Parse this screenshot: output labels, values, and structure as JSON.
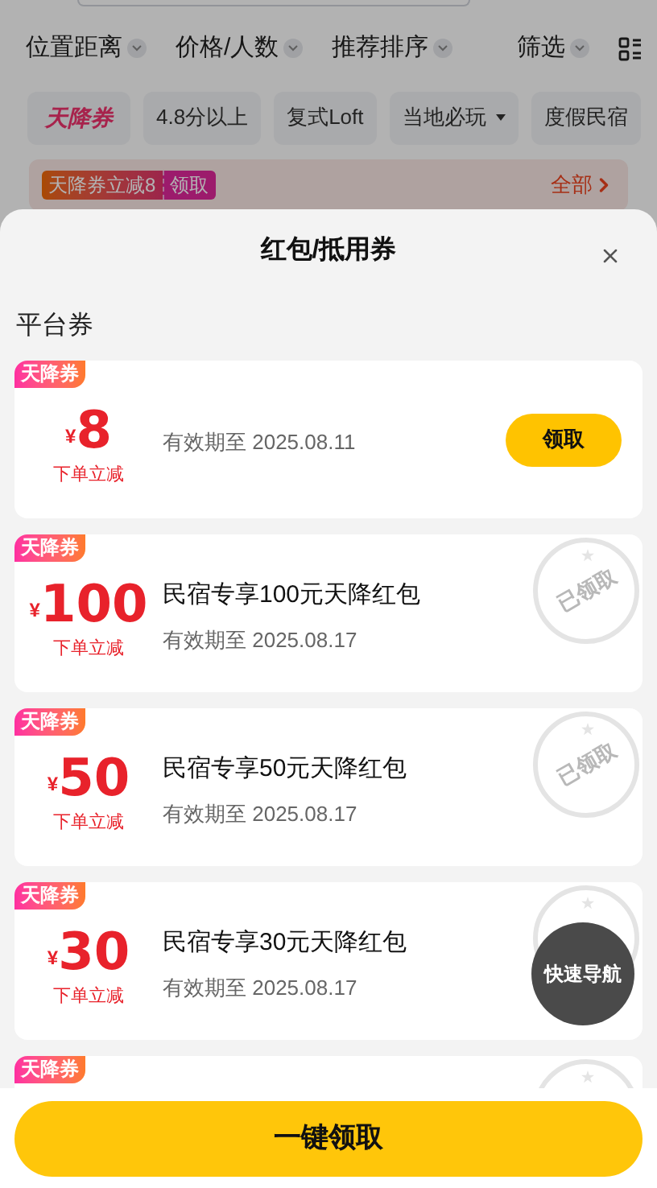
{
  "filters": [
    {
      "label": "位置距离",
      "dropdown": true
    },
    {
      "label": "价格/人数",
      "dropdown": true
    },
    {
      "label": "推荐排序",
      "dropdown": true
    },
    {
      "label": "筛选",
      "dropdown": true
    }
  ],
  "chips": [
    {
      "label": "天降券",
      "kind": "brand"
    },
    {
      "label": "4.8分以上",
      "kind": "plain"
    },
    {
      "label": "复式Loft",
      "kind": "plain"
    },
    {
      "label": "当地必玩",
      "kind": "menu"
    },
    {
      "label": "度假民宿",
      "kind": "plain"
    }
  ],
  "promo": {
    "badge": "天降券立减8",
    "action": "领取",
    "link": "全部"
  },
  "sheet": {
    "title": "红包/抵用券",
    "section": "平台券",
    "coupons": [
      {
        "tag": "天降券",
        "currency": "¥",
        "amount": "8",
        "note": "下单立减",
        "validity": "有效期至 2025.08.11",
        "claimed": false,
        "button": "领取"
      },
      {
        "tag": "天降券",
        "currency": "¥",
        "amount": "100",
        "note": "下单立减",
        "title": "民宿专享100元天降红包",
        "validity": "有效期至 2025.08.17",
        "claimed": true,
        "stamp": "已领取"
      },
      {
        "tag": "天降券",
        "currency": "¥",
        "amount": "50",
        "note": "下单立减",
        "title": "民宿专享50元天降红包",
        "validity": "有效期至 2025.08.17",
        "claimed": true,
        "stamp": "已领取"
      },
      {
        "tag": "天降券",
        "currency": "¥",
        "amount": "30",
        "note": "下单立减",
        "title": "民宿专享30元天降红包",
        "validity": "有效期至 2025.08.17",
        "claimed": true
      },
      {
        "tag": "天降券",
        "claimed": true
      }
    ],
    "claim_all": "一键领取"
  },
  "fab": "快速导航"
}
